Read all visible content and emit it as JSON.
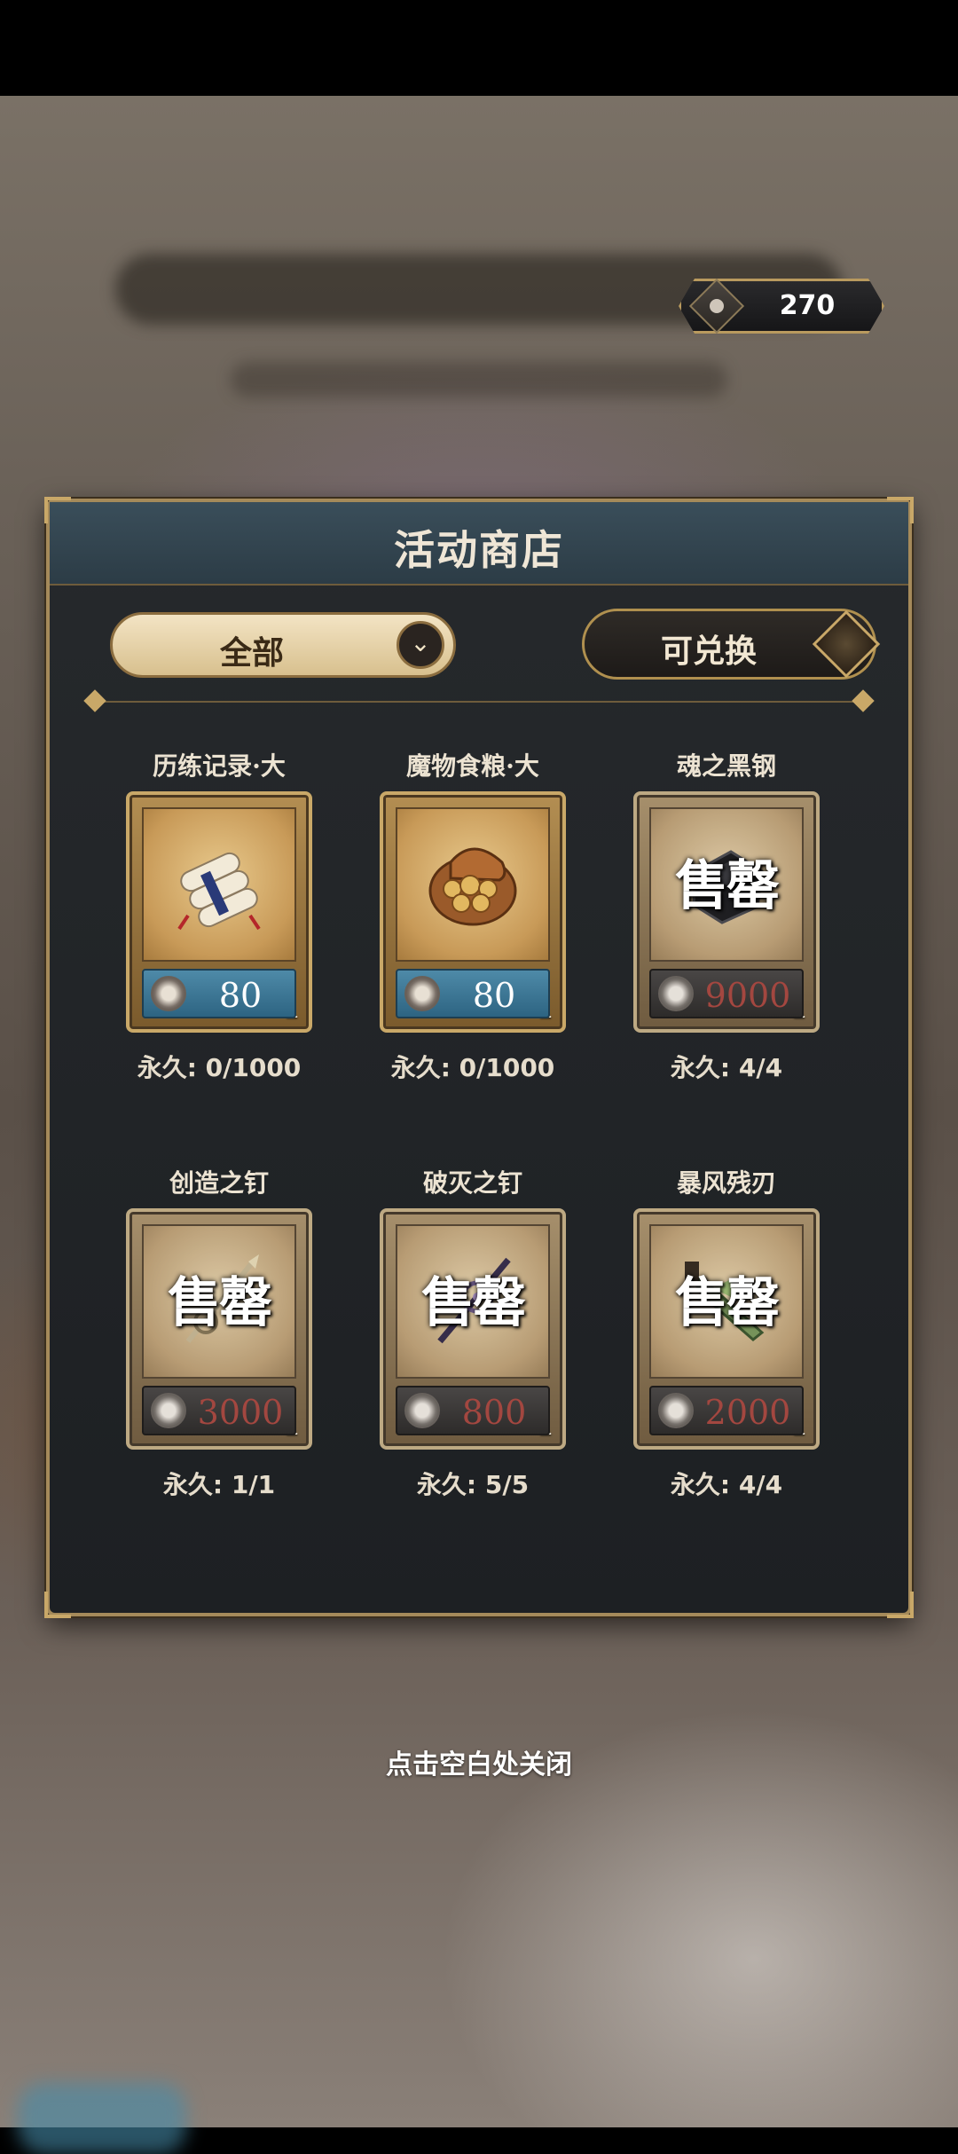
{
  "currency": {
    "amount": "270"
  },
  "shop": {
    "title": "活动商店",
    "filter_label": "全部",
    "toggle_label": "可兑换",
    "sold_out_text": "售罄"
  },
  "items": [
    {
      "name": "历练记录·大",
      "count": "1",
      "price": "80",
      "limit": "永久: 0/1000",
      "sold_out": false
    },
    {
      "name": "魔物食粮·大",
      "count": "1",
      "price": "80",
      "limit": "永久: 0/1000",
      "sold_out": false
    },
    {
      "name": "魂之黑钢",
      "count": "1",
      "price": "9000",
      "limit": "永久: 4/4",
      "sold_out": true
    },
    {
      "name": "创造之钉",
      "count": "1",
      "price": "3000",
      "limit": "永久: 1/1",
      "sold_out": true
    },
    {
      "name": "破灭之钉",
      "count": "1",
      "price": "800",
      "limit": "永久: 5/5",
      "sold_out": true
    },
    {
      "name": "暴风残刃",
      "count": "1",
      "price": "2000",
      "limit": "永久: 4/4",
      "sold_out": true
    }
  ],
  "close_hint": "点击空白处关闭",
  "colors": {
    "accent_gold": "#c9a868",
    "price_available": "#4e8aa8",
    "price_soldout_text": "#d43a2e"
  }
}
